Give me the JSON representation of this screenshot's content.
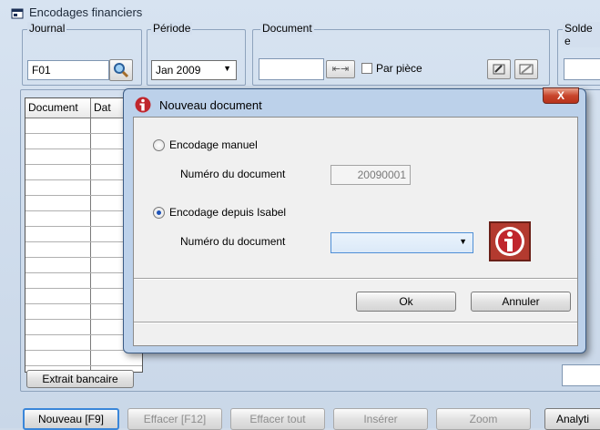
{
  "window": {
    "title": "Encodages financiers"
  },
  "journal": {
    "label": "Journal",
    "value": "F01"
  },
  "periode": {
    "label": "Période",
    "value": "Jan 2009"
  },
  "document": {
    "label": "Document",
    "value": "",
    "par_piece": "Par pièce"
  },
  "solde": {
    "label": "Solde e"
  },
  "grid": {
    "columns": [
      "Document",
      "Dat"
    ]
  },
  "extrait_button": "Extrait bancaire",
  "toolbar": {
    "nouveau": "Nouveau [F9]",
    "effacer": "Effacer [F12]",
    "effacer_tout": "Effacer tout",
    "inserer": "Insérer",
    "zoom": "Zoom",
    "analytique": "Analyti"
  },
  "dialog": {
    "title": "Nouveau document",
    "option_manual": "Encodage manuel",
    "manual_doc_label": "Numéro du document",
    "manual_doc_value": "20090001",
    "option_isabel": "Encodage depuis Isabel",
    "isabel_doc_label": "Numéro du document",
    "isabel_doc_value": "",
    "ok": "Ok",
    "cancel": "Annuler",
    "close": "X",
    "selected_option": "isabel"
  }
}
